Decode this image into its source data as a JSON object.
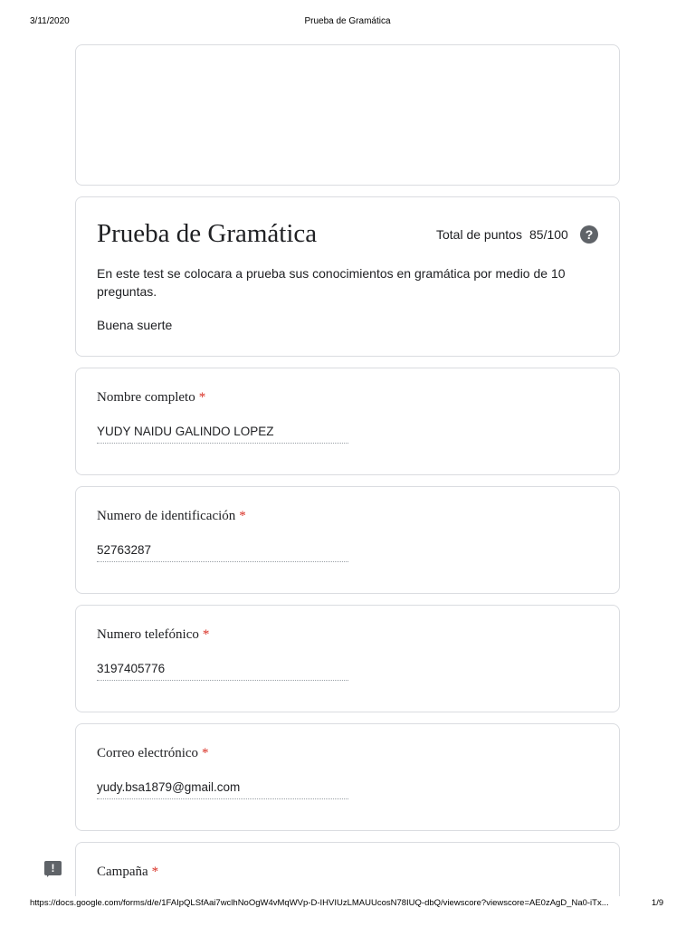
{
  "print_header": {
    "date": "3/11/2020",
    "title": "Prueba de Gramática"
  },
  "form": {
    "title": "Prueba de Gramática",
    "score_label": "Total de puntos",
    "score_value": "85/100",
    "help_glyph": "?",
    "description": "En este test se colocara a prueba sus conocimientos en gramática por medio de 10 preguntas.",
    "description_2": "Buena suerte"
  },
  "questions": [
    {
      "label": "Nombre completo",
      "required": "*",
      "answer": "YUDY NAIDU GALINDO LOPEZ"
    },
    {
      "label": "Numero de identificación",
      "required": "*",
      "answer": "52763287"
    },
    {
      "label": "Numero telefónico",
      "required": "*",
      "answer": "3197405776"
    },
    {
      "label": "Correo electrónico",
      "required": "*",
      "answer": "yudy.bsa1879@gmail.com"
    },
    {
      "label": "Campaña",
      "required": "*"
    }
  ],
  "feedback": {
    "icon": "feedback-icon",
    "glyph": "!"
  },
  "print_footer": {
    "url": "https://docs.google.com/forms/d/e/1FAIpQLSfAai7wclhNoOgW4vMqWVp-D-IHVIUzLMAUUcosN78IUQ-dbQ/viewscore?viewscore=AE0zAgD_Na0-iTx...",
    "page": "1/9"
  }
}
